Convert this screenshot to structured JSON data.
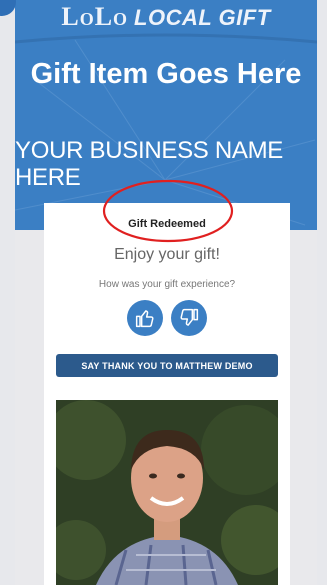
{
  "brand": {
    "lolo": "LoLo",
    "tagline": "LOCAL GIFT"
  },
  "gift": {
    "title": "Gift Item Goes Here",
    "business": "YOUR BUSINESS NAME HERE"
  },
  "card": {
    "status": "Gift Redeemed",
    "message": "Enjoy your gift!",
    "question": "How was your gift experience?",
    "thank_button": "SAY THANK YOU TO MATTHEW DEMO"
  },
  "colors": {
    "hero": "#3b7fc4",
    "button": "#2c5a8c",
    "annotation": "#e02020"
  },
  "icons": [
    "thumbs-up-icon",
    "thumbs-down-icon"
  ]
}
